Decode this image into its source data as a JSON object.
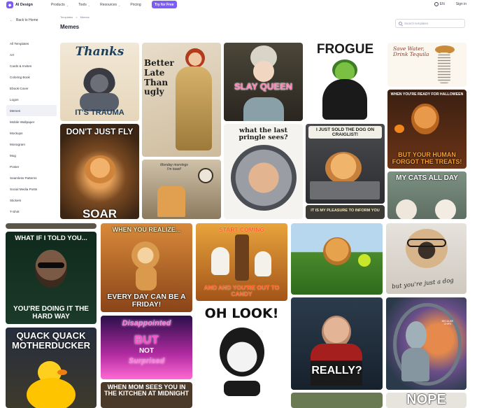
{
  "nav": {
    "logo_text": "AI Design",
    "links": [
      "Products",
      "Tools",
      "Resources",
      "Pricing"
    ],
    "try_button": "Try for Free",
    "language": "EN",
    "signin": "Sign in"
  },
  "sidebar": {
    "back_label": "Back to Home",
    "items": [
      "All Templates",
      "Art",
      "Cards & Invites",
      "Coloring Book",
      "Ebook Cover",
      "Logos",
      "Memes",
      "Mobile Wallpaper",
      "Mockups",
      "Monogram",
      "Mug",
      "Poster",
      "Seamless Patterns",
      "Social Media Posts",
      "Stickers",
      "T-Shirt"
    ],
    "active_index": 6
  },
  "breadcrumb": [
    "Templates",
    ">",
    "Memes"
  ],
  "page_title": "Memes",
  "search": {
    "placeholder": "Search templates"
  },
  "tiles": {
    "thanks_top": "Thanks",
    "thanks_bottom": "IT'S TRAUMA",
    "better_late": "Better Late Than ugly",
    "slay_queen": "SLAY QUEEN",
    "frogue": "FROGUE",
    "tequila": "Save Water, Drink Tequila",
    "halloween_top": "WHEN YOU'RE READY FOR HALLOWEEN",
    "halloween_bottom": "BUT YOUR HUMAN FORGOT THE TREATS!",
    "dont_just_fly": "DON'T JUST FLY",
    "soar": "SOAR",
    "pringle": "what the last pringle sees?",
    "sold_dog": "I JUST SOLD THE DOG ON CRAIGLIST!",
    "monday": "Monday mornings I'm toast!",
    "my_cats": "MY CATS ALL DAY",
    "pleasure": "IT IS MY PLEASURE TO INFORM YOU",
    "what_if_top": "WHAT IF I TOLD YOU...",
    "what_if_bottom": "YOU'RE DOING IT THE HARD WAY",
    "friday_top": "WHEN YOU REALIZE...",
    "friday_bottom": "EVERY DAY CAN BE A FRIDAY!",
    "candy_top": "START COMING",
    "candy_bottom": "AND AND YOU'RE OUT TO CANDY",
    "pug": "but you're just a dog",
    "quack": "QUACK QUACK MOTHERDUCKER",
    "disappointed_1": "Disappointed",
    "disappointed_2": "BUT",
    "disappointed_3": "NOT",
    "disappointed_4": "Surprised",
    "oh_look": "OH LOOK!",
    "really": "REALLY?",
    "mom_kitchen": "WHEN MOM SEES YOU IN THE KITCHEN AT MIDNIGHT",
    "nope": "NOPE",
    "alien_sign": "BECAUSE CHIPS"
  }
}
